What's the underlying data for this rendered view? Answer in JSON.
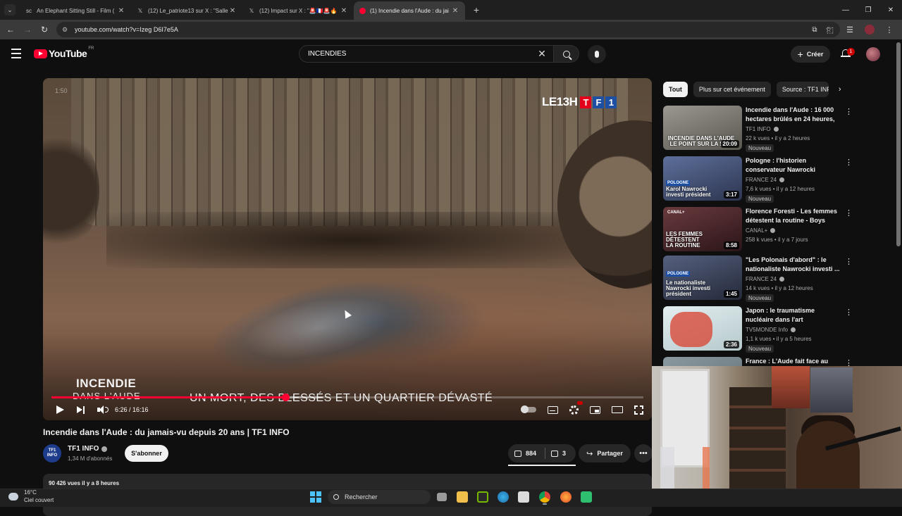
{
  "browser": {
    "tabs": [
      {
        "title": "An Elephant Sitting Still - Film (",
        "favicon": "sc-icon",
        "active": false
      },
      {
        "title": "(12) Le_patriote13 sur X : \"Salle",
        "favicon": "x-icon",
        "active": false
      },
      {
        "title": "(12) Impact sur X : \"🚨🇫🇷🚨🔥",
        "favicon": "x-icon",
        "active": false
      },
      {
        "title": "(1) Incendie dans l'Aude : du jai",
        "favicon": "youtube-icon",
        "active": true
      }
    ],
    "url": "youtube.com/watch?v=Izeg D6I7e5A"
  },
  "youtube": {
    "region": "FR",
    "logo_text": "YouTube",
    "search_value": "INCENDIES",
    "create_label": "Créer",
    "notifications_count": "1"
  },
  "player": {
    "ghost_time": "1:50",
    "brand_text": "LE13H",
    "brand_tf1": [
      "T",
      "F",
      "1"
    ],
    "banner_title": "INCENDIE",
    "banner_sub": "DANS L'AUDE",
    "banner_caption": "UN MORT, DES BLESSÉS ET UN QUARTIER DÉVASTÉ",
    "timecode": "6:26 / 16:16",
    "progress_fraction": 0.395,
    "buffer_fraction": 0.46,
    "colors": {
      "progress": "#ff0033"
    }
  },
  "video": {
    "title": "Incendie dans l'Aude : du jamais-vu depuis 20 ans | TF1 INFO",
    "channel": "TF1 INFO",
    "channel_avatar_lines": [
      "TF1",
      "INFO"
    ],
    "subscribers": "1,34 M d'abonnés",
    "subscribe_label": "S'abonner",
    "likes": "884",
    "dislikes": "3",
    "share_label": "Partager",
    "description_meta": "90 426 vues  il y a 8 heures"
  },
  "chips": [
    "Tout",
    "Plus sur cet événement",
    "Source : TF1 INFO"
  ],
  "recommendations": [
    {
      "title": "Incendie dans l'Aude : 16 000 hectares brûlés en 24 heures, ...",
      "channel": "TF1 INFO",
      "meta": "22 k vues • il y a 2 heures",
      "badge": "Nouveau",
      "duration": "20:09",
      "thumb_caption": "INCENDIE DANS L'AUDE LE POINT SUR LA SITU",
      "thumb_color": "#6b6a63"
    },
    {
      "title": "Pologne : l'historien conservateur Nawrocki investi...",
      "channel": "FRANCE 24",
      "meta": "7,6 k vues • il y a 12 heures",
      "badge": "Nouveau",
      "duration": "3:17",
      "thumb_tag": "POLOGNE",
      "thumb_caption": "Karol Nawrocki investi président",
      "thumb_color": "#3e4f78"
    },
    {
      "title": "Florence Foresti - Les femmes détestent la routine - Boys Boy...",
      "channel": "CANAL+",
      "meta": "258 k vues • il y a 7 jours",
      "badge": "",
      "duration": "8:58",
      "thumb_tag": "CANAL+",
      "thumb_caption": "LES FEMMES DÉTESTENT LA ROUTINE",
      "thumb_color": "#4a2a2e"
    },
    {
      "title": "\"Les Polonais d'abord\" : le nationaliste Nawrocki investi ...",
      "channel": "FRANCE 24",
      "meta": "14 k vues • il y a 12 heures",
      "badge": "Nouveau",
      "duration": "1:45",
      "thumb_tag": "POLOGNE",
      "thumb_caption": "Le nationaliste Nawrocki investi président",
      "thumb_color": "#3d4866"
    },
    {
      "title": "Japon : le traumatisme nucléaire dans l'art",
      "channel": "TV5MONDE Info",
      "meta": "1,1 k vues • il y a 5 heures",
      "badge": "Nouveau",
      "duration": "2:36",
      "thumb_color": "#d7e3e6"
    },
    {
      "title": "France : L'Aude fait face au plus",
      "channel": "",
      "meta": "",
      "badge": "",
      "duration": "",
      "thumb_color": "#7a8a90"
    }
  ],
  "taskbar": {
    "temperature": "16°C",
    "weather": "Ciel couvert",
    "search_label": "Rechercher"
  }
}
